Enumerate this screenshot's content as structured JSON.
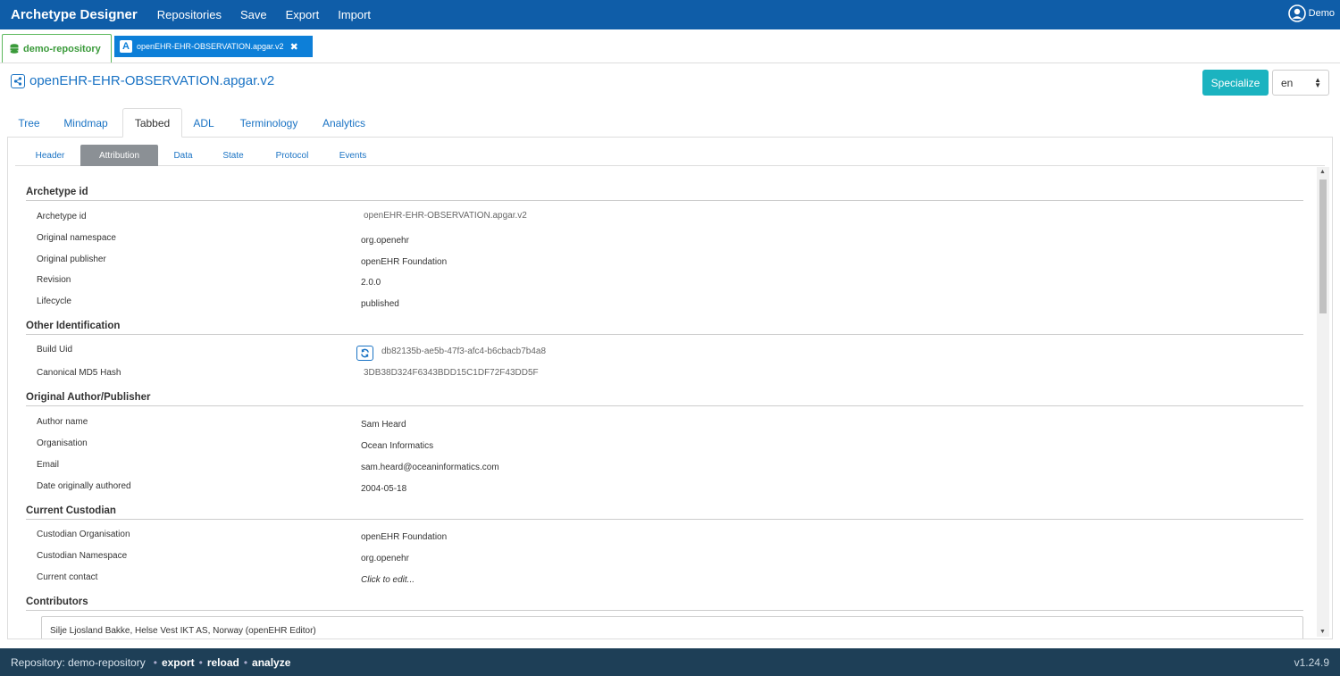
{
  "navbar": {
    "brand": "Archetype Designer",
    "links": [
      "Repositories",
      "Save",
      "Export",
      "Import"
    ],
    "user": "Demo"
  },
  "doc_tabs": {
    "repo": "demo-repository",
    "file": "openEHR-EHR-OBSERVATION.apgar.v2",
    "file_badge": "A"
  },
  "title": "openEHR-EHR-OBSERVATION.apgar.v2",
  "specialize": "Specialize",
  "language": "en",
  "main_tabs": [
    "Tree",
    "Mindmap",
    "Tabbed",
    "ADL",
    "Terminology",
    "Analytics"
  ],
  "sub_tabs": [
    "Header",
    "Attribution",
    "Data",
    "State",
    "Protocol",
    "Events"
  ],
  "sections": {
    "archetype_id": {
      "heading": "Archetype id",
      "rows": [
        {
          "label": "Archetype id",
          "value": "openEHR-EHR-OBSERVATION.apgar.v2"
        },
        {
          "label": "Original namespace",
          "value": "org.openehr"
        },
        {
          "label": "Original publisher",
          "value": "openEHR Foundation"
        },
        {
          "label": "Revision",
          "value": "2.0.0"
        },
        {
          "label": "Lifecycle",
          "value": "published"
        }
      ]
    },
    "other_identification": {
      "heading": "Other Identification",
      "rows": [
        {
          "label": "Build Uid",
          "value": "db82135b-ae5b-47f3-afc4-b6cbacb7b4a8"
        },
        {
          "label": "Canonical MD5 Hash",
          "value": "3DB38D324F6343BDD15C1DF72F43DD5F"
        }
      ]
    },
    "original_author": {
      "heading": "Original Author/Publisher",
      "rows": [
        {
          "label": "Author name",
          "value": "Sam Heard"
        },
        {
          "label": "Organisation",
          "value": "Ocean Informatics"
        },
        {
          "label": "Email",
          "value": "sam.heard@oceaninformatics.com"
        },
        {
          "label": "Date originally authored",
          "value": "2004-05-18"
        }
      ]
    },
    "current_custodian": {
      "heading": "Current Custodian",
      "rows": [
        {
          "label": "Custodian Organisation",
          "value": "openEHR Foundation"
        },
        {
          "label": "Custodian Namespace",
          "value": "org.openehr"
        },
        {
          "label": "Current contact",
          "value": "Click to edit..."
        }
      ]
    },
    "contributors": {
      "heading": "Contributors",
      "first": "Silje Ljosland Bakke, Helse Vest IKT AS, Norway (openEHR Editor)"
    }
  },
  "footer": {
    "repo_label": "Repository: demo-repository",
    "links": [
      "export",
      "reload",
      "analyze"
    ],
    "version": "v1.24.9"
  },
  "colors": {
    "navbar": "#0f5da8",
    "accent": "#1a73c4",
    "specialize": "#1bb3c0",
    "repo_tab": "#5cb85c",
    "footer": "#1e3f57"
  }
}
